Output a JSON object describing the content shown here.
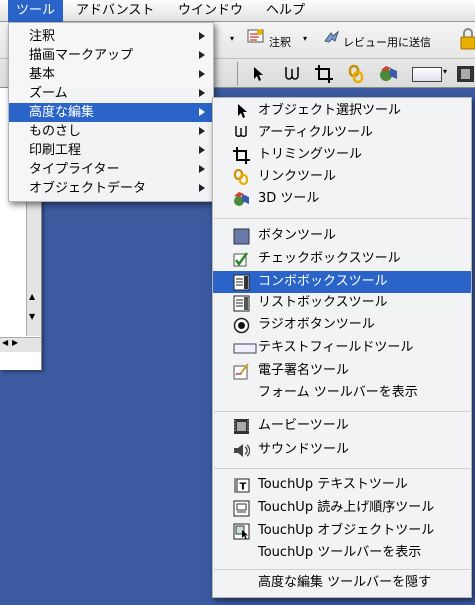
{
  "menubar": {
    "items": [
      "ツール",
      "アドバンスト",
      "ウインドウ",
      "ヘルプ"
    ],
    "active_index": 0
  },
  "toolbar": {
    "annotate_label": "注釈",
    "send_review_label": "レビュー用に送信"
  },
  "tools_menu": {
    "items": [
      {
        "label": "注釈",
        "submenu": true
      },
      {
        "label": "描画マークアップ",
        "submenu": true
      },
      {
        "label": "基本",
        "submenu": true
      },
      {
        "label": "ズーム",
        "submenu": true
      },
      {
        "label": "高度な編集",
        "submenu": true,
        "selected": true
      },
      {
        "label": "ものさし",
        "submenu": true
      },
      {
        "label": "印刷工程",
        "submenu": true
      },
      {
        "label": "タイプライター",
        "submenu": true
      },
      {
        "label": "オブジェクトデータ",
        "submenu": true
      }
    ]
  },
  "advanced_editing_menu": {
    "group1": [
      {
        "label": "オブジェクト選択ツール",
        "icon": "arrow-cursor-icon"
      },
      {
        "label": "アーティクルツール",
        "icon": "article-icon"
      },
      {
        "label": "トリミングツール",
        "icon": "crop-icon"
      },
      {
        "label": "リンクツール",
        "icon": "link-icon"
      },
      {
        "label": "3D ツール",
        "icon": "3d-icon"
      }
    ],
    "group2": [
      {
        "label": "ボタンツール",
        "icon": "button-icon"
      },
      {
        "label": "チェックボックスツール",
        "icon": "checkbox-icon"
      },
      {
        "label": "コンボボックスツール",
        "icon": "combobox-icon",
        "selected": true
      },
      {
        "label": "リストボックスツール",
        "icon": "listbox-icon"
      },
      {
        "label": "ラジオボタンツール",
        "icon": "radio-button-icon"
      },
      {
        "label": "テキストフィールドツール",
        "icon": "text-field-icon"
      },
      {
        "label": "電子署名ツール",
        "icon": "signature-icon"
      },
      {
        "label": "フォーム ツールバーを表示",
        "icon": ""
      }
    ],
    "group3": [
      {
        "label": "ムービーツール",
        "icon": "film-icon"
      },
      {
        "label": "サウンドツール",
        "icon": "speaker-icon"
      }
    ],
    "group4": [
      {
        "label": "TouchUp テキストツール",
        "icon": "touchup-text-icon"
      },
      {
        "label": "TouchUp 読み上げ順序ツール",
        "icon": "reading-order-icon"
      },
      {
        "label": "TouchUp オブジェクトツール",
        "icon": "touchup-object-icon"
      },
      {
        "label": "TouchUp  ツールバーを表示",
        "icon": ""
      }
    ],
    "group5": [
      {
        "label": "高度な編集 ツールバーを隠す",
        "icon": ""
      }
    ]
  },
  "colors": {
    "highlight": "#2a64c8",
    "desktop": "#3c5aa0"
  }
}
